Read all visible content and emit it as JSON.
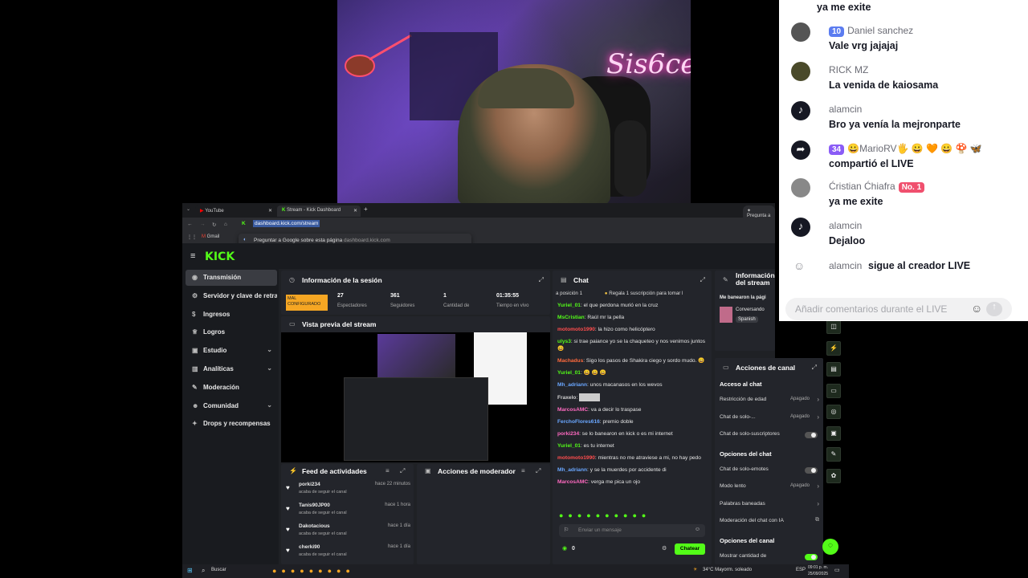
{
  "colors": {
    "kick_green": "#53fc18",
    "tiktok_bg": "#ffffff",
    "dark_panel": "#23252b"
  },
  "browser": {
    "tabs": [
      {
        "label": "YouTube",
        "icon": "youtube-icon"
      },
      {
        "label": "Stream - Kick Dashboard",
        "icon": "kick-icon"
      }
    ],
    "new_tab": "+",
    "url": "dashboard.kick.com/stream",
    "right_tab": "Pregunta a",
    "bookmark": "Gmail",
    "suggestion": "Preguntar a Google sobre esta página",
    "suggestion_url": "dashboard.kick.com",
    "logo": "KICK"
  },
  "sidebar": {
    "items": [
      {
        "label": "Transmisión",
        "icon": "broadcast-icon",
        "chevron": ""
      },
      {
        "label": "Servidor y clave de retransmisión",
        "icon": "gear-icon",
        "chevron": ""
      },
      {
        "label": "Ingresos",
        "icon": "dollar-icon",
        "chevron": ""
      },
      {
        "label": "Logros",
        "icon": "trophy-icon",
        "chevron": ""
      },
      {
        "label": "Estudio",
        "icon": "studio-icon",
        "chevron": "⌄"
      },
      {
        "label": "Analíticas",
        "icon": "analytics-icon",
        "chevron": "⌄"
      },
      {
        "label": "Moderación",
        "icon": "wrench-icon",
        "chevron": ""
      },
      {
        "label": "Comunidad",
        "icon": "community-icon",
        "chevron": "⌄"
      },
      {
        "label": "Drops y recompensas",
        "icon": "gift-icon",
        "chevron": ""
      }
    ]
  },
  "session": {
    "title": "Información de la sesión",
    "status": "MAL CONFIGURADO",
    "stats": [
      {
        "value": "27",
        "label": "Espectadores"
      },
      {
        "value": "361",
        "label": "Seguidores"
      },
      {
        "value": "1",
        "label": "Cantidad de"
      },
      {
        "value": "01:35:55",
        "label": "Tiempo en vivo"
      }
    ]
  },
  "preview": {
    "title": "Vista previa del stream"
  },
  "feed": {
    "title": "Feed de actividades",
    "items": [
      {
        "user": "porki234",
        "time": "hace 22 minutos",
        "action": "acaba de seguir el canal"
      },
      {
        "user": "Tanis90JP00",
        "time": "hace 1 hora",
        "action": "acaba de seguir el canal"
      },
      {
        "user": "Dakotacious",
        "time": "hace 1 día",
        "action": "acaba de seguir el canal"
      },
      {
        "user": "cherki90",
        "time": "hace 1 día",
        "action": "acaba de seguir el canal"
      }
    ]
  },
  "mod_actions": {
    "title": "Acciones de moderador"
  },
  "chat": {
    "title": "Chat",
    "pinned": "Regala 1 suscripción para tomar l",
    "position": "a posición 1",
    "messages": [
      {
        "user": "Yuriel_01",
        "color": "#53fc18",
        "text": "el que perdona murió en la cruz"
      },
      {
        "user": "MsCristian",
        "color": "#53fc18",
        "text": "Raúl mr la pella"
      },
      {
        "user": "motomoto1990",
        "color": "#ff4d4d",
        "text": "la hizo como helicóptero"
      },
      {
        "user": "ulys3",
        "color": "#53fc18",
        "text": "si trae paiance yo se la chaqueteo y nos venimos juntos 😀"
      },
      {
        "user": "Machadus",
        "color": "#ff6a3d",
        "text": "Sigo los pasos de Shakira ciego y sordo mudo. 😀"
      },
      {
        "user": "Yuriel_01",
        "color": "#53fc18",
        "text": "😀 😀 😀"
      },
      {
        "user": "Mh_adriann",
        "color": "#6aa7ff",
        "text": "unos macanasos en los wevos"
      },
      {
        "user": "Fraxelo",
        "color": "#cfcfcf",
        "text": ""
      },
      {
        "user": "MarcosAMC",
        "color": "#ff6ac1",
        "text": "va a decir lo traspase"
      },
      {
        "user": "FerchoFlores616",
        "color": "#6aa7ff",
        "text": "premio doble"
      },
      {
        "user": "porki234",
        "color": "#ff6ac1",
        "text": "se lo banearon en kick o es mi internet"
      },
      {
        "user": "Yuriel_01",
        "color": "#53fc18",
        "text": "es tu internet"
      },
      {
        "user": "motomoto1990",
        "color": "#ff4d4d",
        "text": "mientras no me atraviese a mi, no hay pedo"
      },
      {
        "user": "Mh_adriann",
        "color": "#6aa7ff",
        "text": "y se la muerdes por accidente di"
      },
      {
        "user": "MarcosAMC",
        "color": "#ff6ac1",
        "text": "verga me pica un ojo"
      }
    ],
    "input_placeholder": "Enviar un mensaje",
    "points": "0",
    "send_button": "Chatear"
  },
  "stream_info": {
    "title": "Información del stream",
    "subtitle": "Me banearon la pági",
    "category": "Conversando",
    "language": "Spanish"
  },
  "channel_actions": {
    "title": "Acciones de canal",
    "sections": [
      {
        "heading": "Acceso al chat",
        "rows": [
          {
            "label": "Restricción de edad",
            "value": "Apagado",
            "control": "chevron"
          },
          {
            "label": "Chat de solo-...",
            "value": "Apagado",
            "control": "chevron"
          },
          {
            "label": "Chat de solo-suscriptores",
            "value": "",
            "control": "toggle"
          }
        ]
      },
      {
        "heading": "Opciones del chat",
        "rows": [
          {
            "label": "Chat de solo-emotes",
            "value": "",
            "control": "toggle"
          },
          {
            "label": "Modo lento",
            "value": "Apagado",
            "control": "chevron"
          },
          {
            "label": "Palabras baneadas",
            "value": "",
            "control": "chevron"
          },
          {
            "label": "Moderación del chat con IA",
            "value": "",
            "control": "external"
          }
        ]
      },
      {
        "heading": "Opciones del canal",
        "rows": [
          {
            "label": "Mostrar cantidad de",
            "value": "",
            "control": "toggle-on"
          }
        ]
      }
    ]
  },
  "taskbar": {
    "search": "Buscar",
    "weather": "34°C  Mayorm. soleado",
    "lang": "ESP",
    "time": "09:01 p. m.",
    "date": "25/09/2025"
  },
  "tiktok": {
    "top_message": "ya me exite",
    "comments": [
      {
        "name": "Daniel sanchez",
        "badge": "10",
        "badge_color": "#5b7cf0",
        "msg": "Vale vrg jajajaj",
        "avatar": "#555"
      },
      {
        "name": "RICK MZ",
        "badge": "",
        "badge_color": "",
        "msg": "La venida de kaiosama",
        "avatar": "#4a4a2a"
      },
      {
        "name": "alamcin",
        "badge": "",
        "badge_color": "",
        "msg": "Bro ya venía la mejronparte",
        "avatar": "#161823"
      },
      {
        "name": "😀MarioRV🖐 😀 🧡 😀 🍄 🦋",
        "badge": "34",
        "badge_color": "#8a5cf6",
        "msg": "compartió el LIVE",
        "avatar": "#161823"
      },
      {
        "name": "Ćristian Ćhiafra",
        "badge": "No. 1",
        "badge_color": "#f0506e",
        "msg": "ya me exite",
        "avatar": "#888"
      },
      {
        "name": "alamcin",
        "badge": "",
        "badge_color": "",
        "msg": "Dejaloo",
        "avatar": "#161823"
      }
    ],
    "follow_event": {
      "name": "alamcin",
      "msg": "sigue al creador LIVE"
    },
    "input_placeholder": "Añadir comentarios durante el LIVE"
  }
}
